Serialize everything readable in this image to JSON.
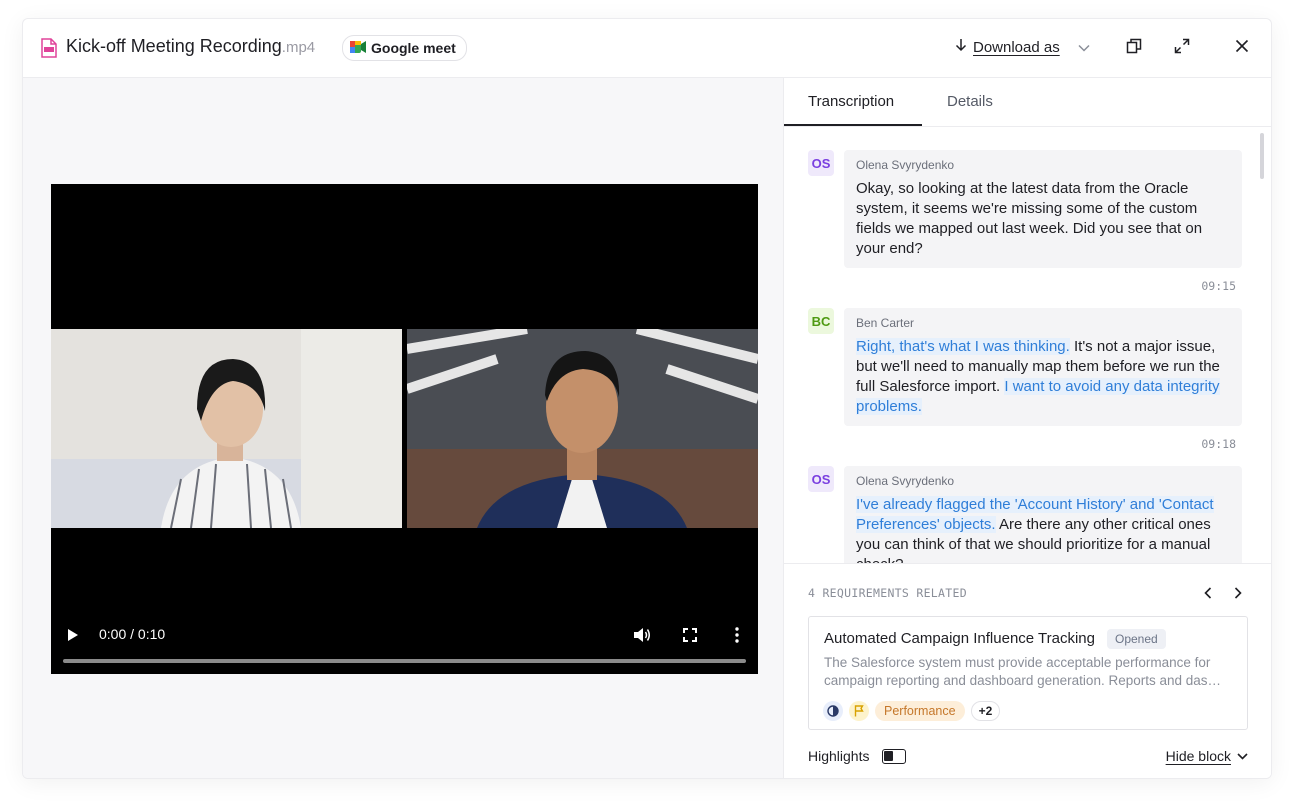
{
  "header": {
    "file_name": "Kick-off Meeting Recording",
    "file_ext": ".mp4",
    "source_label": "Google meet",
    "download_label": "Download as"
  },
  "video": {
    "time_display": "0:00 / 0:10",
    "progress": 0
  },
  "tabs": [
    {
      "label": "Transcription",
      "active": true
    },
    {
      "label": "Details",
      "active": false
    }
  ],
  "transcript": [
    {
      "initials": "OS",
      "speaker": "Olena Svyrydenko",
      "segments": [
        {
          "text": "Okay, so looking at the latest data from the Oracle system, it seems we're missing some of the custom fields we mapped out last week. Did you see that on your end?",
          "highlight": false
        }
      ],
      "timestamp": "09:15"
    },
    {
      "initials": "BC",
      "speaker": "Ben Carter",
      "segments": [
        {
          "text": "Right, that's what I was thinking.",
          "highlight": true
        },
        {
          "text": " It's not a major issue, but we'll need to manually map them before we run the full Salesforce import. ",
          "highlight": false
        },
        {
          "text": "I want to avoid any data integrity problems.",
          "highlight": true
        }
      ],
      "timestamp": "09:18"
    },
    {
      "initials": "OS",
      "speaker": "Olena Svyrydenko",
      "segments": [
        {
          "text": "I've already flagged the 'Account History' and 'Contact Preferences' objects.",
          "highlight": true
        },
        {
          "text": " Are there any other critical ones you can think of that we should prioritize for a manual check?",
          "highlight": false
        }
      ],
      "timestamp": ""
    }
  ],
  "requirements": {
    "heading": "4 REQUIREMENTS RELATED",
    "card": {
      "title": "Automated Campaign Influence Tracking",
      "status": "Opened",
      "description": "The Salesforce system must provide acceptable performance for campaign reporting and dashboard generation. Reports and das…",
      "tag_label": "Performance",
      "more_count": "+2"
    }
  },
  "footer": {
    "highlights_label": "Highlights",
    "highlights_on": true,
    "hide_block_label": "Hide block"
  },
  "colors": {
    "accent_blue": "#2f7ed8",
    "os_avatar": "#7a3fe0",
    "bc_avatar": "#4f9a12",
    "performance_tag": "#c5772a"
  }
}
